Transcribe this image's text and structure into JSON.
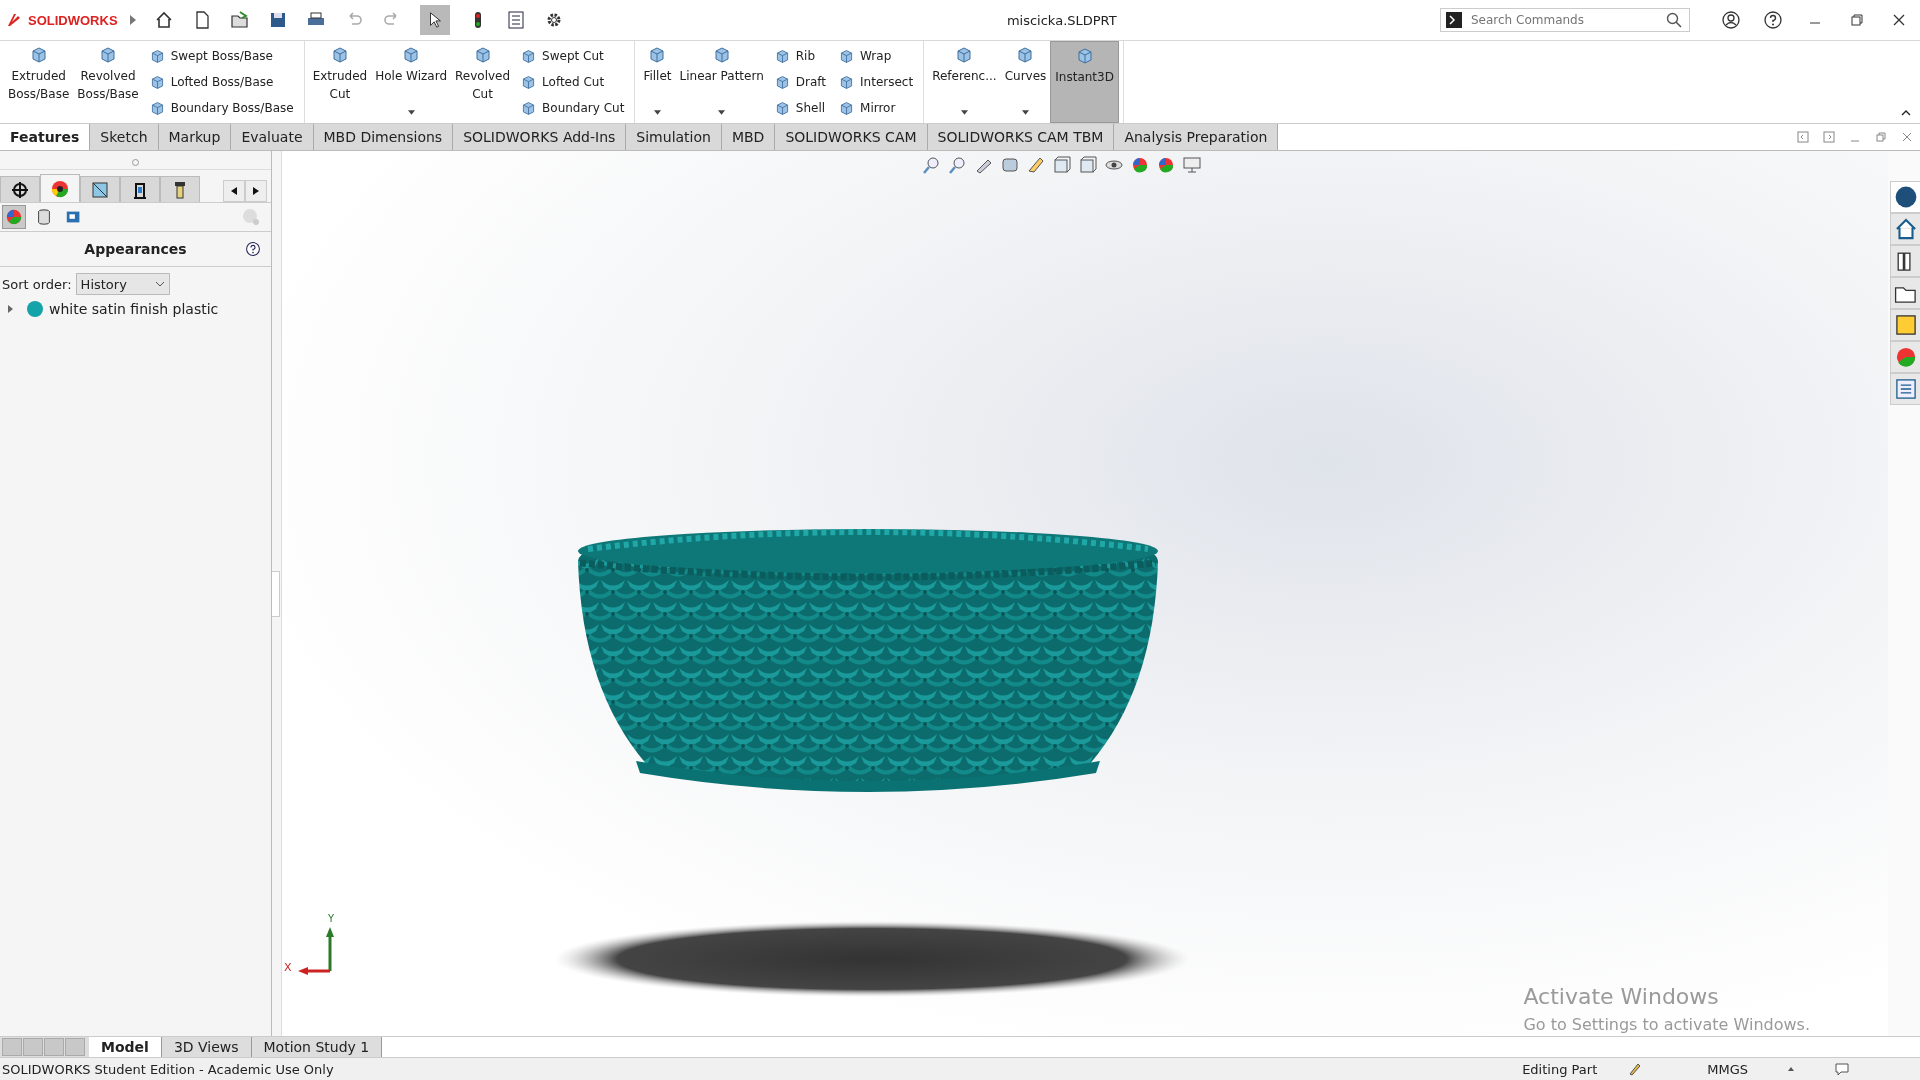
{
  "title_bar": {
    "app_name": "SOLIDWORKS",
    "document": "miscicka.SLDPRT",
    "search": {
      "placeholder": "Search Commands"
    }
  },
  "ribbon": [
    {
      "items": [
        {
          "kind": "large",
          "lines": [
            "Extruded",
            "Boss/Base"
          ],
          "dropdown": false,
          "selected": false
        },
        {
          "kind": "large",
          "lines": [
            "Revolved",
            "Boss/Base"
          ],
          "dropdown": false,
          "selected": false
        },
        {
          "kind": "stack",
          "labels": [
            "Swept Boss/Base",
            "Lofted Boss/Base",
            "Boundary Boss/Base"
          ]
        }
      ]
    },
    {
      "items": [
        {
          "kind": "large",
          "lines": [
            "Extruded",
            "Cut"
          ],
          "dropdown": false,
          "selected": false
        },
        {
          "kind": "large",
          "lines": [
            "Hole Wizard"
          ],
          "dropdown": true,
          "selected": false
        },
        {
          "kind": "large",
          "lines": [
            "Revolved",
            "Cut"
          ],
          "dropdown": false,
          "selected": false
        },
        {
          "kind": "stack",
          "labels": [
            "Swept Cut",
            "Lofted Cut",
            "Boundary Cut"
          ]
        }
      ]
    },
    {
      "items": [
        {
          "kind": "large",
          "lines": [
            "Fillet"
          ],
          "dropdown": true,
          "selected": false
        },
        {
          "kind": "large",
          "lines": [
            "Linear Pattern"
          ],
          "dropdown": true,
          "selected": false
        },
        {
          "kind": "stack",
          "labels": [
            "Rib",
            "Draft",
            "Shell"
          ]
        },
        {
          "kind": "stack",
          "labels": [
            "Wrap",
            "Intersect",
            "Mirror"
          ]
        }
      ]
    },
    {
      "items": [
        {
          "kind": "large",
          "lines": [
            "Referenc..."
          ],
          "dropdown": true,
          "selected": false
        },
        {
          "kind": "large",
          "lines": [
            "Curves"
          ],
          "dropdown": true,
          "selected": false
        },
        {
          "kind": "large",
          "lines": [
            "Instant3D"
          ],
          "dropdown": false,
          "selected": true
        }
      ]
    }
  ],
  "command_tabs": [
    {
      "label": "Features",
      "selected": true
    },
    {
      "label": "Sketch",
      "selected": false
    },
    {
      "label": "Markup",
      "selected": false
    },
    {
      "label": "Evaluate",
      "selected": false
    },
    {
      "label": "MBD Dimensions",
      "selected": false
    },
    {
      "label": "SOLIDWORKS Add-Ins",
      "selected": false
    },
    {
      "label": "Simulation",
      "selected": false
    },
    {
      "label": "MBD",
      "selected": false
    },
    {
      "label": "SOLIDWORKS CAM",
      "selected": false
    },
    {
      "label": "SOLIDWORKS CAM TBM",
      "selected": false
    },
    {
      "label": "Analysis Preparation",
      "selected": false
    }
  ],
  "left_panel": {
    "manager_tabs": [
      {
        "selected": false
      },
      {
        "selected": true
      },
      {
        "selected": false
      },
      {
        "selected": false
      },
      {
        "selected": false
      }
    ],
    "sub_tabs": [
      {
        "selected": true
      },
      {
        "selected": false
      },
      {
        "selected": false
      }
    ],
    "title": "Appearances",
    "sort_label": "Sort order:",
    "sort_value": "History",
    "tree": [
      {
        "label": "white satin finish plastic",
        "color": "#14a3a8",
        "expanded": false
      }
    ]
  },
  "viewport": {
    "triad": {
      "y_label": "Y",
      "x_label": "X"
    },
    "activation_notice": {
      "title": "Activate Windows",
      "subtitle": "Go to Settings to activate Windows."
    }
  },
  "bottom_tabs": [
    {
      "label": "Model",
      "selected": true
    },
    {
      "label": "3D Views",
      "selected": false
    },
    {
      "label": "Motion Study 1",
      "selected": false
    }
  ],
  "status_bar": {
    "message": "SOLIDWORKS Student Edition - Academic Use Only",
    "mode": "Editing Part",
    "units": "MMGS"
  }
}
